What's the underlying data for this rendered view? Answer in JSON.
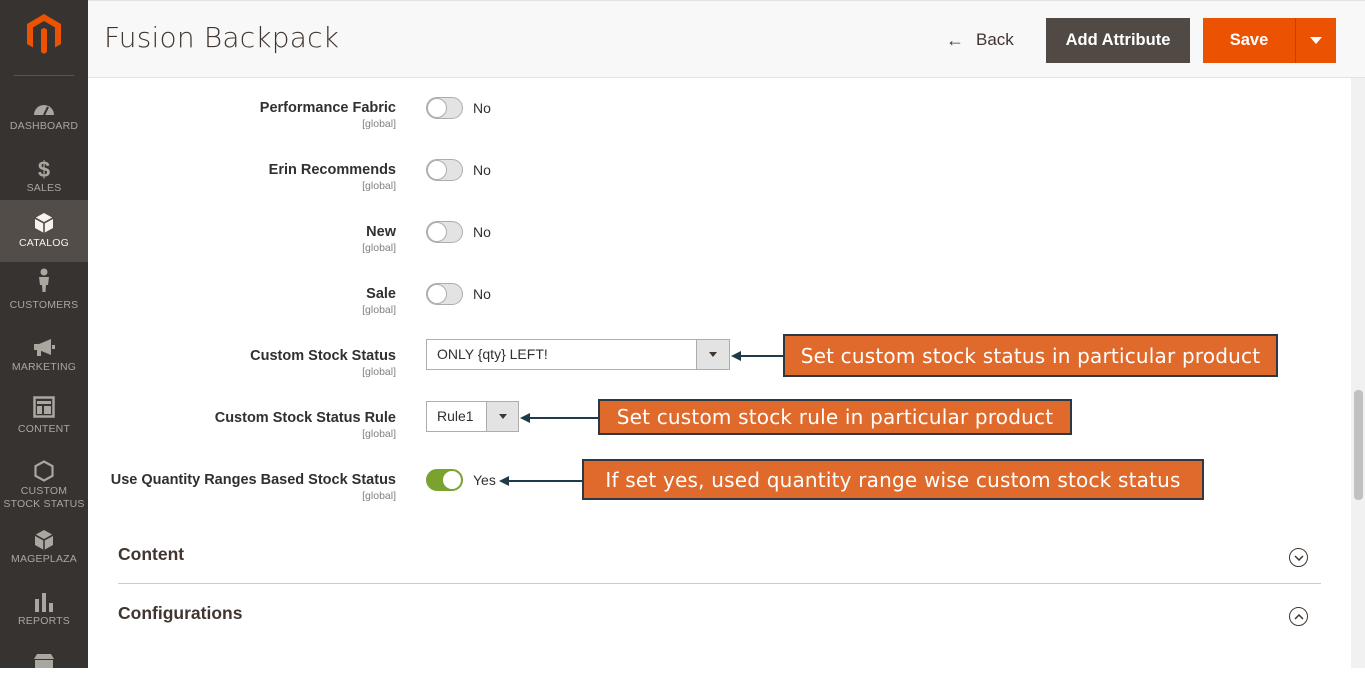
{
  "sidebar": {
    "logo": "magento-logo",
    "items": [
      {
        "label": "DASHBOARD",
        "icon": "dashboard-icon"
      },
      {
        "label": "SALES",
        "icon": "dollar-icon"
      },
      {
        "label": "CATALOG",
        "icon": "cube-icon",
        "active": true
      },
      {
        "label": "CUSTOMERS",
        "icon": "person-icon"
      },
      {
        "label": "MARKETING",
        "icon": "megaphone-icon"
      },
      {
        "label": "CONTENT",
        "icon": "layout-icon"
      },
      {
        "label": "CUSTOM STOCK STATUS",
        "icon": "hexagon-icon"
      },
      {
        "label": "MAGEPLAZA",
        "icon": "mageplaza-cube-icon"
      },
      {
        "label": "REPORTS",
        "icon": "bar-chart-icon"
      }
    ]
  },
  "header": {
    "title": "Fusion Backpack",
    "back_label": "Back",
    "add_attribute_label": "Add Attribute",
    "save_label": "Save"
  },
  "form": {
    "rows": [
      {
        "label": "Performance Fabric",
        "scope": "[global]",
        "value": "No"
      },
      {
        "label": "Erin Recommends",
        "scope": "[global]",
        "value": "No"
      },
      {
        "label": "New",
        "scope": "[global]",
        "value": "No"
      },
      {
        "label": "Sale",
        "scope": "[global]",
        "value": "No"
      },
      {
        "label": "Custom Stock Status",
        "scope": "[global]",
        "value": "ONLY {qty} LEFT!"
      },
      {
        "label": "Custom Stock Status Rule",
        "scope": "[global]",
        "value": "Rule1"
      },
      {
        "label": "Use Quantity Ranges Based Stock Status",
        "scope": "[global]",
        "value": "Yes"
      }
    ]
  },
  "callouts": {
    "stock_status": "Set custom stock status in particular product",
    "stock_rule": "Set custom stock rule in particular product",
    "qty_ranges": "If set yes, used quantity range wise custom stock status"
  },
  "sections": {
    "content": "Content",
    "configurations": "Configurations"
  },
  "colors": {
    "sidebar_bg": "#373330",
    "accent": "#eb5202",
    "secondary_button": "#514943",
    "toggle_on": "#79a22e",
    "callout_bg": "#e06a2b"
  }
}
